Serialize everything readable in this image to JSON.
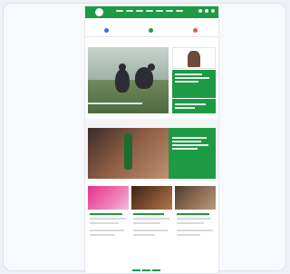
{
  "header": {
    "logo_text": "",
    "nav_items": [
      "",
      "",
      "",
      "",
      "",
      "",
      ""
    ],
    "icons": [
      "search-icon",
      "user-icon",
      "menu-icon"
    ],
    "brand_color": "#1d9a44"
  },
  "shortcuts": [
    {
      "label": "",
      "color": "#3a6fd8"
    },
    {
      "label": "",
      "color": "#1d9a44"
    },
    {
      "label": "",
      "color": "#e65a4a"
    }
  ],
  "sections": {
    "second_label": ""
  }
}
